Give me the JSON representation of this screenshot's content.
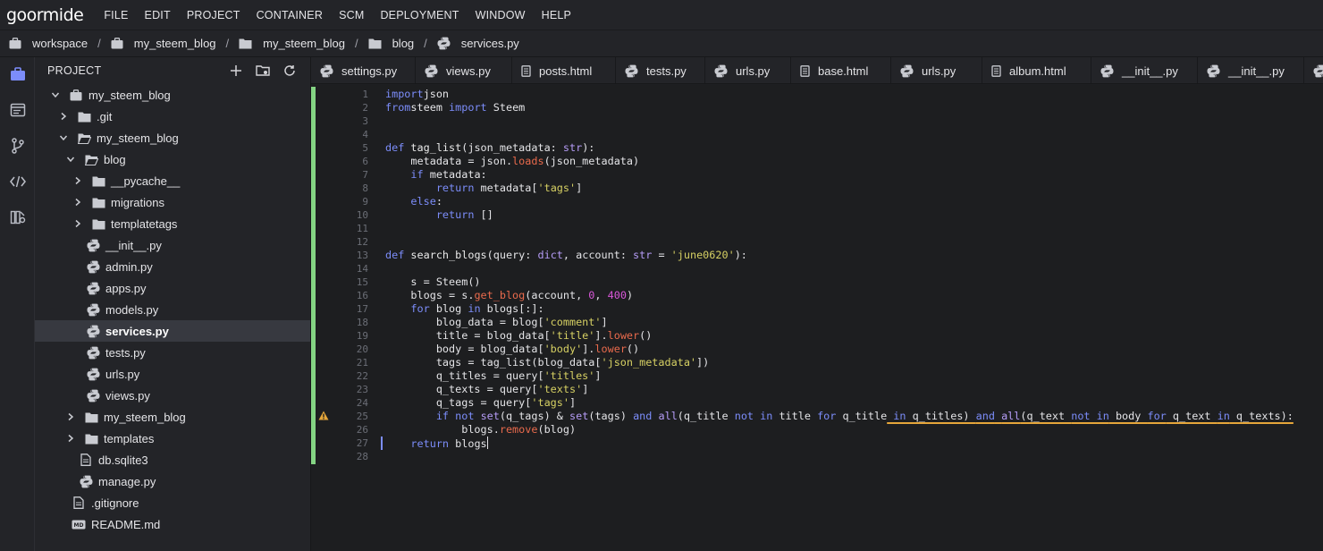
{
  "app": {
    "logo": "goormide"
  },
  "menu": [
    "FILE",
    "EDIT",
    "PROJECT",
    "CONTAINER",
    "SCM",
    "DEPLOYMENT",
    "WINDOW",
    "HELP"
  ],
  "breadcrumb": [
    {
      "label": "workspace",
      "icon": "briefcase-icon"
    },
    {
      "label": "my_steem_blog",
      "icon": "briefcase-icon"
    },
    {
      "label": "my_steem_blog",
      "icon": "folder-icon"
    },
    {
      "label": "blog",
      "icon": "folder-icon"
    },
    {
      "label": "services.py",
      "icon": "python-icon"
    }
  ],
  "sidebar": {
    "title": "PROJECT",
    "tree": [
      {
        "label": "my_steem_blog",
        "depth": 0,
        "icon": "briefcase-icon",
        "chevron": "down"
      },
      {
        "label": ".git",
        "depth": 1,
        "icon": "folder-icon",
        "chevron": "right"
      },
      {
        "label": "my_steem_blog",
        "depth": 1,
        "icon": "folder-open-icon",
        "chevron": "down"
      },
      {
        "label": "blog",
        "depth": 2,
        "icon": "folder-open-icon",
        "chevron": "down"
      },
      {
        "label": "__pycache__",
        "depth": 3,
        "icon": "folder-icon",
        "chevron": "right"
      },
      {
        "label": "migrations",
        "depth": 3,
        "icon": "folder-icon",
        "chevron": "right"
      },
      {
        "label": "templatetags",
        "depth": 3,
        "icon": "folder-icon",
        "chevron": "right"
      },
      {
        "label": "__init__.py",
        "depth": 3,
        "icon": "python-icon",
        "chevron": "none"
      },
      {
        "label": "admin.py",
        "depth": 3,
        "icon": "python-icon",
        "chevron": "none"
      },
      {
        "label": "apps.py",
        "depth": 3,
        "icon": "python-icon",
        "chevron": "none"
      },
      {
        "label": "models.py",
        "depth": 3,
        "icon": "python-icon",
        "chevron": "none"
      },
      {
        "label": "services.py",
        "depth": 3,
        "icon": "python-icon",
        "chevron": "none",
        "selected": true
      },
      {
        "label": "tests.py",
        "depth": 3,
        "icon": "python-icon",
        "chevron": "none"
      },
      {
        "label": "urls.py",
        "depth": 3,
        "icon": "python-icon",
        "chevron": "none"
      },
      {
        "label": "views.py",
        "depth": 3,
        "icon": "python-icon",
        "chevron": "none"
      },
      {
        "label": "my_steem_blog",
        "depth": 2,
        "icon": "folder-icon",
        "chevron": "right"
      },
      {
        "label": "templates",
        "depth": 2,
        "icon": "folder-icon",
        "chevron": "right"
      },
      {
        "label": "db.sqlite3",
        "depth": 2,
        "icon": "file-icon",
        "chevron": "none"
      },
      {
        "label": "manage.py",
        "depth": 2,
        "icon": "python-icon",
        "chevron": "none"
      },
      {
        "label": ".gitignore",
        "depth": 1,
        "icon": "file-icon",
        "chevron": "none"
      },
      {
        "label": "README.md",
        "depth": 1,
        "icon": "markdown-icon",
        "chevron": "none"
      }
    ]
  },
  "tabs": [
    {
      "label": "settings.py",
      "icon": "python-icon"
    },
    {
      "label": "views.py",
      "icon": "python-icon"
    },
    {
      "label": "posts.html",
      "icon": "html-icon"
    },
    {
      "label": "tests.py",
      "icon": "python-icon"
    },
    {
      "label": "urls.py",
      "icon": "python-icon"
    },
    {
      "label": "base.html",
      "icon": "html-icon"
    },
    {
      "label": "urls.py",
      "icon": "python-icon"
    },
    {
      "label": "album.html",
      "icon": "html-icon"
    },
    {
      "label": "__init__.py",
      "icon": "python-icon"
    },
    {
      "label": "__init__.py",
      "icon": "python-icon"
    },
    {
      "label": "",
      "icon": "python-icon"
    }
  ],
  "editor": {
    "active_line": 27,
    "warning_line": 25,
    "lines": [
      [
        [
          "kw",
          "import"
        ],
        [
          "",
          "json"
        ]
      ],
      [
        [
          "kw",
          "from"
        ],
        [
          "",
          "steem "
        ],
        [
          "kw",
          "import"
        ],
        [
          "",
          " Steem"
        ]
      ],
      [],
      [],
      [
        [
          "kw",
          "def"
        ],
        [
          "",
          " "
        ],
        [
          "fn",
          "tag_list"
        ],
        [
          "",
          "(json_metadata: "
        ],
        [
          "bi",
          "str"
        ],
        [
          "",
          "):"
        ]
      ],
      [
        [
          "",
          "    metadata = json."
        ],
        [
          "meth",
          "loads"
        ],
        [
          "",
          "(json_metadata)"
        ]
      ],
      [
        [
          "",
          "    "
        ],
        [
          "kw",
          "if"
        ],
        [
          "",
          " metadata:"
        ]
      ],
      [
        [
          "",
          "        "
        ],
        [
          "kw",
          "return"
        ],
        [
          "",
          " metadata["
        ],
        [
          "str",
          "'tags'"
        ],
        [
          "",
          "]"
        ]
      ],
      [
        [
          "",
          "    "
        ],
        [
          "kw",
          "else"
        ],
        [
          "",
          ":"
        ]
      ],
      [
        [
          "",
          "        "
        ],
        [
          "kw",
          "return"
        ],
        [
          "",
          " []"
        ]
      ],
      [],
      [],
      [
        [
          "kw",
          "def"
        ],
        [
          "",
          " "
        ],
        [
          "fn",
          "search_blogs"
        ],
        [
          "",
          "(query: "
        ],
        [
          "bi",
          "dict"
        ],
        [
          "",
          ", account: "
        ],
        [
          "bi",
          "str"
        ],
        [
          "",
          " = "
        ],
        [
          "str",
          "'june0620'"
        ],
        [
          "",
          "):"
        ]
      ],
      [],
      [
        [
          "",
          "    s = Steem()"
        ]
      ],
      [
        [
          "",
          "    blogs = s."
        ],
        [
          "meth",
          "get_blog"
        ],
        [
          "",
          "(account, "
        ],
        [
          "num",
          "0"
        ],
        [
          "",
          ", "
        ],
        [
          "num",
          "400"
        ],
        [
          "",
          ")"
        ]
      ],
      [
        [
          "",
          "    "
        ],
        [
          "kw",
          "for"
        ],
        [
          "",
          " blog "
        ],
        [
          "kw",
          "in"
        ],
        [
          "",
          " blogs[:]:"
        ]
      ],
      [
        [
          "",
          "        blog_data = blog["
        ],
        [
          "str",
          "'comment'"
        ],
        [
          "",
          "]"
        ]
      ],
      [
        [
          "",
          "        title = blog_data["
        ],
        [
          "str",
          "'title'"
        ],
        [
          "",
          "]."
        ],
        [
          "meth",
          "lower"
        ],
        [
          "",
          "()"
        ]
      ],
      [
        [
          "",
          "        body = blog_data["
        ],
        [
          "str",
          "'body'"
        ],
        [
          "",
          "]."
        ],
        [
          "meth",
          "lower"
        ],
        [
          "",
          "()"
        ]
      ],
      [
        [
          "",
          "        tags = tag_list(blog_data["
        ],
        [
          "str",
          "'json_metadata'"
        ],
        [
          "",
          "])"
        ]
      ],
      [
        [
          "",
          "        q_titles = query["
        ],
        [
          "str",
          "'titles'"
        ],
        [
          "",
          "]"
        ]
      ],
      [
        [
          "",
          "        q_texts = query["
        ],
        [
          "str",
          "'texts'"
        ],
        [
          "",
          "]"
        ]
      ],
      [
        [
          "",
          "        q_tags = query["
        ],
        [
          "str",
          "'tags'"
        ],
        [
          "",
          "]"
        ]
      ],
      [
        [
          "",
          "        "
        ],
        [
          "kw",
          "if"
        ],
        [
          "",
          " "
        ],
        [
          "kw",
          "not"
        ],
        [
          "",
          " "
        ],
        [
          "bi",
          "set"
        ],
        [
          "",
          "(q_tags) & "
        ],
        [
          "bi",
          "set"
        ],
        [
          "",
          "(tags) "
        ],
        [
          "kw",
          "and"
        ],
        [
          "",
          " "
        ],
        [
          "bi",
          "all"
        ],
        [
          "",
          "(q_title "
        ],
        [
          "kw",
          "not in"
        ],
        [
          "",
          " title "
        ],
        [
          "kw",
          "for"
        ],
        [
          "",
          " q_title"
        ],
        [
          "kw sq",
          " in"
        ],
        [
          "sq",
          " q_titles) "
        ],
        [
          "kw sq",
          "and"
        ],
        [
          "sq",
          " "
        ],
        [
          "bi sq",
          "all"
        ],
        [
          "sq",
          "(q_text "
        ],
        [
          "kw sq",
          "not in"
        ],
        [
          "sq",
          " body "
        ],
        [
          "kw sq",
          "for"
        ],
        [
          "sq",
          " q_text "
        ],
        [
          "kw sq",
          "in"
        ],
        [
          "sq",
          " q_texts):"
        ]
      ],
      [
        [
          "",
          "            blogs."
        ],
        [
          "meth",
          "remove"
        ],
        [
          "",
          "(blog)"
        ]
      ],
      [
        [
          "",
          "    "
        ],
        [
          "kw",
          "return"
        ],
        [
          "",
          " blogs"
        ]
      ],
      []
    ]
  },
  "colors": {
    "accent": "#7c8dfa",
    "git_change": "#84d483",
    "warning": "#e5a63a"
  }
}
